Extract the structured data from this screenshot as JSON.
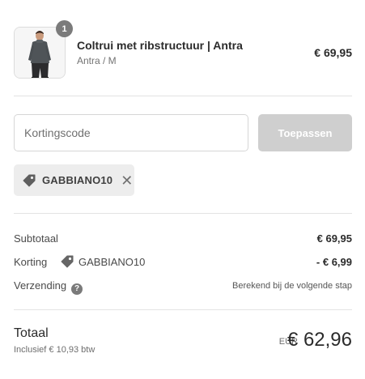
{
  "product": {
    "quantity": "1",
    "title": "Coltrui met ribstructuur | Antra",
    "variant": "Antra / M",
    "price": "€ 69,95"
  },
  "discount": {
    "placeholder": "Kortingscode",
    "value": "",
    "apply_label": "Toepassen",
    "applied_code": "GABBIANO10",
    "remove_glyph": "✕"
  },
  "summary": {
    "subtotal_label": "Subtotaal",
    "subtotal_value": "€ 69,95",
    "discount_label": "Korting",
    "discount_code": "GABBIANO10",
    "discount_value": "- € 6,99",
    "shipping_label": "Verzending",
    "shipping_help": "?",
    "shipping_value": "Berekend bij de volgende stap"
  },
  "total": {
    "label": "Totaal",
    "tax_note": "Inclusief € 10,93 btw",
    "currency": "EUR",
    "value": "€ 62,96"
  },
  "icons": {
    "tag": "tag-icon",
    "close": "close-icon",
    "help": "question-circle-icon"
  },
  "colors": {
    "button_disabled": "#cfcfcf",
    "chip_background": "#ededed",
    "badge": "#7b7b7b"
  }
}
